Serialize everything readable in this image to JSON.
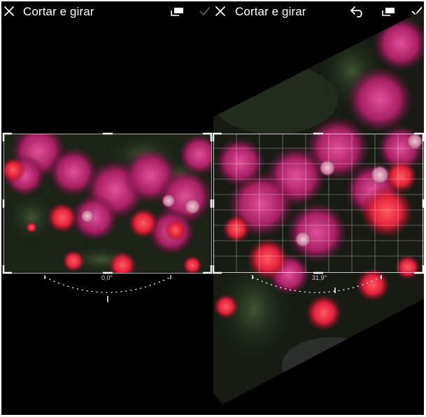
{
  "panels": [
    {
      "title": "Cortar e girar",
      "angle_label": "0,0°",
      "toolbar_icons": [
        "close-icon",
        "aspect-ratio-icon",
        "confirm-check-icon"
      ],
      "confirm_enabled": false
    },
    {
      "title": "Cortar e girar",
      "angle_label": "31,9°",
      "toolbar_icons": [
        "close-icon",
        "undo-icon",
        "aspect-ratio-icon",
        "confirm-check-icon"
      ],
      "confirm_enabled": true
    }
  ],
  "colors": {
    "background": "#000000",
    "text": "#ffffff",
    "check_disabled": "#5a5a5a",
    "flower_magenta": "#b5246a",
    "flower_red": "#e8213a",
    "foliage": "#2b3a26"
  }
}
